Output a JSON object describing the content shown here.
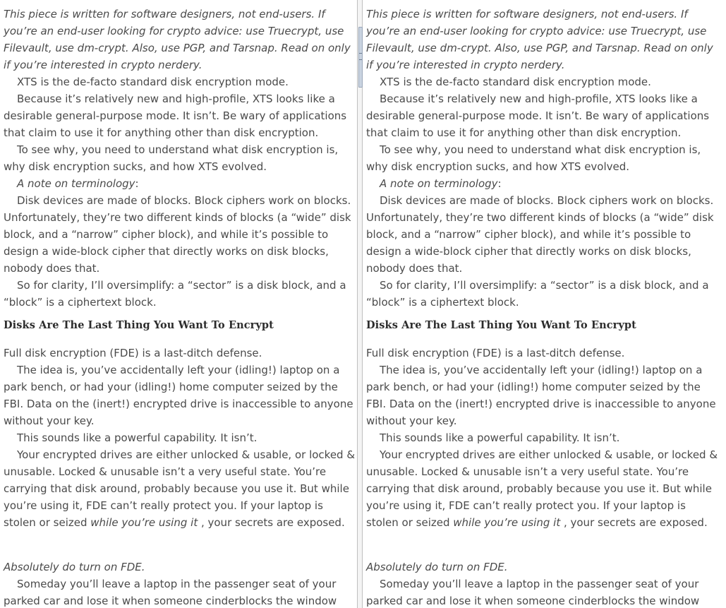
{
  "doc": {
    "intro": "This piece is written for software designers, not end-users. If you’re an end-user looking for crypto advice: use Truecrypt, use Filevault, use dm-crypt. Also, use PGP, and Tarsnap. Read on only if you’re interested in crypto nerdery.",
    "p1": "XTS is the de-facto standard disk encryption mode.",
    "p2": "Because it’s relatively new and high-profile, XTS looks like a desirable general-purpose mode. It isn’t. Be wary of applications that claim to use it for anything other than disk encryption.",
    "p3": "To see why, you need to understand what disk encryption is, why disk encryption sucks, and how XTS evolved.",
    "note_label": "A note on terminology",
    "note_colon": ":",
    "p4": "Disk devices are made of blocks. Block ciphers work on blocks. Unfortunately, they’re two different kinds of blocks (a “wide” disk block, and a “narrow” cipher block), and while it’s possible to design a wide-block cipher that directly works on disk blocks, nobody does that.",
    "p5": "So for clarity, I’ll oversimplify: a “sector” is a disk block, and a “block” is a ciphertext block.",
    "heading": "Disks Are The Last Thing You Want To Encrypt",
    "p6": "Full disk encryption (FDE) is a last-ditch defense.",
    "p7": "The idea is, you’ve accidentally left your (idling!) laptop on a park bench, or had your (idling!) home computer seized by the FBI. Data on the (inert!) encrypted drive is inaccessible to anyone without your key.",
    "p8": "This sounds like a powerful capability. It isn’t.",
    "p9_start": "Your encrypted drives are either unlocked & usable, or locked & unusable. Locked & unusable isn’t a very useful state. You’re carrying that disk around, probably because you use it. But while you’re using it, FDE can’t really protect you. If your laptop is stolen or seized ",
    "p9_italic": "while you’re using it",
    "p9_end": " , your secrets are exposed.",
    "p10": "Absolutely do turn on FDE.",
    "p11": "Someday you’ll leave a laptop in the passenger seat of your parked car and lose it when someone cinderblocks the window"
  }
}
